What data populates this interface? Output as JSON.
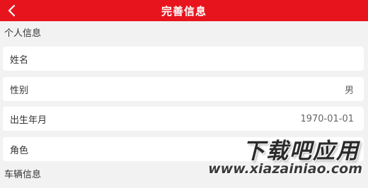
{
  "header": {
    "title": "完善信息",
    "back_icon": "chevron-left-icon",
    "background_color": "#e8141d"
  },
  "sections": {
    "personal": "个人信息",
    "vehicle": "车辆信息"
  },
  "fields": {
    "name": {
      "label": "姓名",
      "value": ""
    },
    "gender": {
      "label": "性别",
      "value": "男"
    },
    "birth": {
      "label": "出生年月",
      "value": "1970-01-01"
    },
    "role": {
      "label": "角色",
      "value": ""
    }
  },
  "watermark": {
    "title": "下载吧应用",
    "url": "www.xiazainiao.com"
  }
}
